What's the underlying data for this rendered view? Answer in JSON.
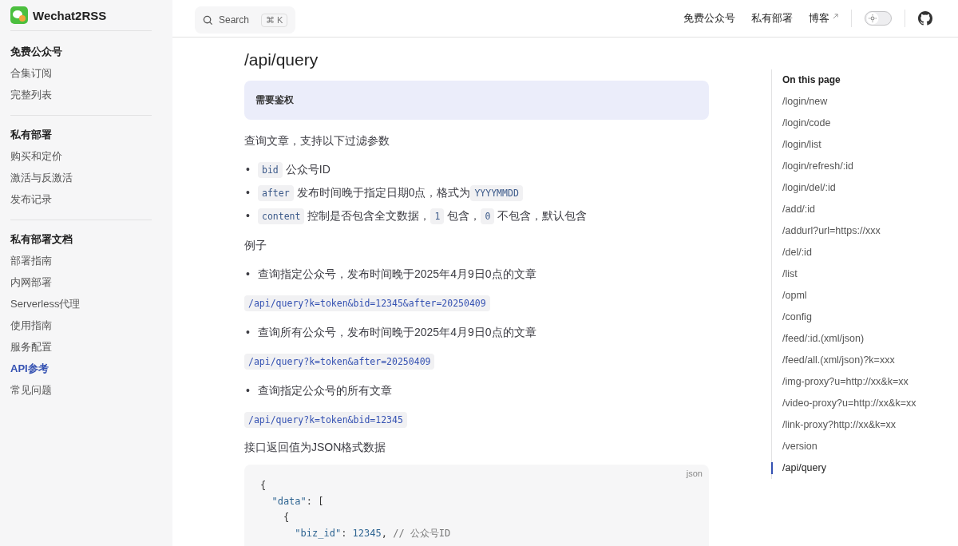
{
  "site": {
    "name": "Wechat2RSS"
  },
  "search": {
    "placeholder": "Search",
    "shortcut": "⌘ K"
  },
  "nav": [
    {
      "label": "免费公众号",
      "external": false
    },
    {
      "label": "私有部署",
      "external": false
    },
    {
      "label": "博客",
      "external": true
    }
  ],
  "theme_toggle": {
    "on": false
  },
  "sidebar": [
    {
      "title": "免费公众号",
      "items": [
        {
          "label": "合集订阅",
          "selected": false
        },
        {
          "label": "完整列表",
          "selected": false
        }
      ]
    },
    {
      "title": "私有部署",
      "items": [
        {
          "label": "购买和定价",
          "selected": false
        },
        {
          "label": "激活与反激活",
          "selected": false
        },
        {
          "label": "发布记录",
          "selected": false
        }
      ]
    },
    {
      "title": "私有部署文档",
      "items": [
        {
          "label": "部署指南",
          "selected": false
        },
        {
          "label": "内网部署",
          "selected": false
        },
        {
          "label": "Serverless代理",
          "selected": false
        },
        {
          "label": "使用指南",
          "selected": false
        },
        {
          "label": "服务配置",
          "selected": false
        },
        {
          "label": "API参考",
          "selected": true
        },
        {
          "label": "常见问题",
          "selected": false
        }
      ]
    }
  ],
  "heading": "/api/query",
  "notice": "需要鉴权",
  "blocks": [
    {
      "kind": "para",
      "parts": [
        {
          "kind": "text",
          "text": "查询文章，支持以下过滤参数"
        }
      ]
    },
    {
      "kind": "list",
      "bullet": "•",
      "items": [
        [
          {
            "kind": "code",
            "text": "bid"
          },
          {
            "kind": "text",
            "text": "公众号ID"
          }
        ],
        [
          {
            "kind": "code",
            "text": "after"
          },
          {
            "kind": "text",
            "text": "发布时间晚于指定日期0点，格式为"
          },
          {
            "kind": "code",
            "text": "YYYYMMDD"
          }
        ],
        [
          {
            "kind": "code",
            "text": "content"
          },
          {
            "kind": "text",
            "text": "控制是否包含全文数据，"
          },
          {
            "kind": "code",
            "text": "1"
          },
          {
            "kind": "text",
            "text": "包含，"
          },
          {
            "kind": "code",
            "text": "0"
          },
          {
            "kind": "text",
            "text": "不包含，默认包含"
          }
        ]
      ]
    },
    {
      "kind": "para",
      "parts": [
        {
          "kind": "text",
          "text": "例子"
        }
      ]
    },
    {
      "kind": "list",
      "bullet": "•",
      "items": [
        [
          {
            "kind": "text",
            "text": "查询指定公众号，发布时间晚于2025年4月9日0点的文章"
          }
        ]
      ]
    },
    {
      "kind": "para",
      "parts": [
        {
          "kind": "code",
          "text": "/api/query?k=token&bid=12345&after=20250409"
        }
      ]
    },
    {
      "kind": "list",
      "bullet": "•",
      "items": [
        [
          {
            "kind": "text",
            "text": "查询所有公众号，发布时间晚于2025年4月9日0点的文章"
          }
        ]
      ]
    },
    {
      "kind": "para",
      "parts": [
        {
          "kind": "code",
          "text": "/api/query?k=token&after=20250409"
        }
      ]
    },
    {
      "kind": "list",
      "bullet": "•",
      "items": [
        [
          {
            "kind": "text",
            "text": "查询指定公众号的所有文章"
          }
        ]
      ]
    },
    {
      "kind": "para",
      "parts": [
        {
          "kind": "code",
          "text": "/api/query?k=token&bid=12345"
        }
      ]
    },
    {
      "kind": "para",
      "parts": [
        {
          "kind": "text",
          "text": "接口返回值为JSON格式数据"
        }
      ]
    }
  ],
  "code_block": {
    "language": "json",
    "lines": [
      [
        {
          "kind": "punct",
          "text": "{"
        }
      ],
      [
        {
          "kind": "key",
          "text": "  \"data\""
        },
        {
          "kind": "punct",
          "text": ": ["
        }
      ],
      [
        {
          "kind": "punct",
          "text": "    {"
        }
      ],
      [
        {
          "kind": "key",
          "text": "      \"biz_id\""
        },
        {
          "kind": "punct",
          "text": ": "
        },
        {
          "kind": "number",
          "text": "12345"
        },
        {
          "kind": "punct",
          "text": ", "
        },
        {
          "kind": "comment",
          "text": "// 公众号ID"
        }
      ]
    ]
  },
  "toc": {
    "title": "On this page",
    "items": [
      {
        "label": "/login/new",
        "selected": false
      },
      {
        "label": "/login/code",
        "selected": false
      },
      {
        "label": "/login/list",
        "selected": false
      },
      {
        "label": "/login/refresh/:id",
        "selected": false
      },
      {
        "label": "/login/del/:id",
        "selected": false
      },
      {
        "label": "/add/:id",
        "selected": false
      },
      {
        "label": "/addurl?url=https://xxx",
        "selected": false
      },
      {
        "label": "/del/:id",
        "selected": false
      },
      {
        "label": "/list",
        "selected": false
      },
      {
        "label": "/opml",
        "selected": false
      },
      {
        "label": "/config",
        "selected": false
      },
      {
        "label": "/feed/:id.(xml/json)",
        "selected": false
      },
      {
        "label": "/feed/all.(xml/json)?k=xxx",
        "selected": false
      },
      {
        "label": "/img-proxy?u=http://xx&k=xx",
        "selected": false
      },
      {
        "label": "/video-proxy?u=http://xx&k=xx",
        "selected": false
      },
      {
        "label": "/link-proxy?http://xx&k=xx",
        "selected": false
      },
      {
        "label": "/version",
        "selected": false
      },
      {
        "label": "/api/query",
        "selected": true
      }
    ]
  }
}
